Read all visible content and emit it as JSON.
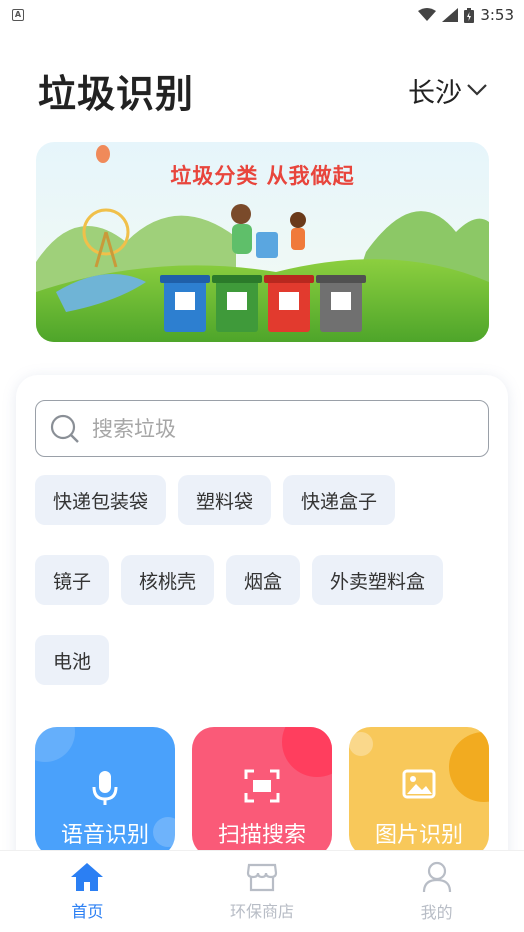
{
  "status_bar": {
    "time": "3:53"
  },
  "header": {
    "title": "垃圾识别",
    "city": "长沙"
  },
  "banner": {
    "slogan": "垃圾分类  从我做起"
  },
  "search": {
    "placeholder": "搜索垃圾"
  },
  "hot_tags": [
    [
      "快递包装袋",
      "塑料袋",
      "快递盒子"
    ],
    [
      "镜子",
      "核桃壳",
      "烟盒",
      "外卖塑料盒"
    ],
    [
      "电池"
    ]
  ],
  "actions": [
    {
      "label": "语音识别",
      "color": "#4aa1fb",
      "icon": "mic-icon"
    },
    {
      "label": "扫描搜索",
      "color": "#fa5a78",
      "icon": "scan-icon"
    },
    {
      "label": "图片识别",
      "color": "#f8c85a",
      "icon": "image-icon"
    }
  ],
  "tabs": [
    {
      "label": "首页",
      "icon": "home-icon",
      "active": true
    },
    {
      "label": "环保商店",
      "icon": "store-icon",
      "active": false
    },
    {
      "label": "我的",
      "icon": "user-icon",
      "active": false
    }
  ],
  "colors": {
    "accent": "#2b7ff3",
    "tag_bg": "#ecf1f9",
    "slogan": "#e8453c"
  }
}
